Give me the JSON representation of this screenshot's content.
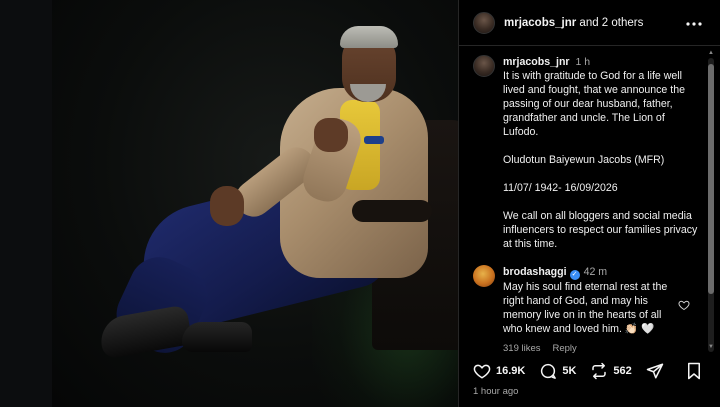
{
  "header": {
    "username": "mrjacobs_jnr",
    "collab_text": " and 2 others",
    "more_icon": "more-horizontal-icon"
  },
  "caption": {
    "username": "mrjacobs_jnr",
    "time": "1 h",
    "paragraph1": "It is with gratitude to God for a life well lived and fought, that we announce the passing of our dear husband, father, grandfather and uncle. The Lion of Lufodo.",
    "paragraph2": "Oludotun Baiyewun Jacobs (MFR)",
    "paragraph3": "11/07/ 1942- 16/09/2026",
    "paragraph4": "We call on all bloggers and social media influencers to respect our families privacy at this time."
  },
  "comment": {
    "username": "brodashaggi",
    "verified_icon": "verified-badge-icon",
    "time": "42 m",
    "text": "May his soul find eternal rest at the right hand of God, and may his memory live on in the hearts of all who knew and loved him. 👏🏻 🤍",
    "likes": "319 likes",
    "reply": "Reply"
  },
  "actions": {
    "likes": "16.9K",
    "comments": "5K",
    "reposts": "562",
    "icons": [
      "heart-icon",
      "comment-icon",
      "repost-icon",
      "share-icon",
      "bookmark-icon"
    ]
  },
  "posted": "1 hour ago",
  "colors": {
    "background": "#000000",
    "text": "#f5f5f5",
    "secondary_text": "#a8a8a8",
    "verified": "#3a8ef7",
    "divider": "#262626"
  }
}
